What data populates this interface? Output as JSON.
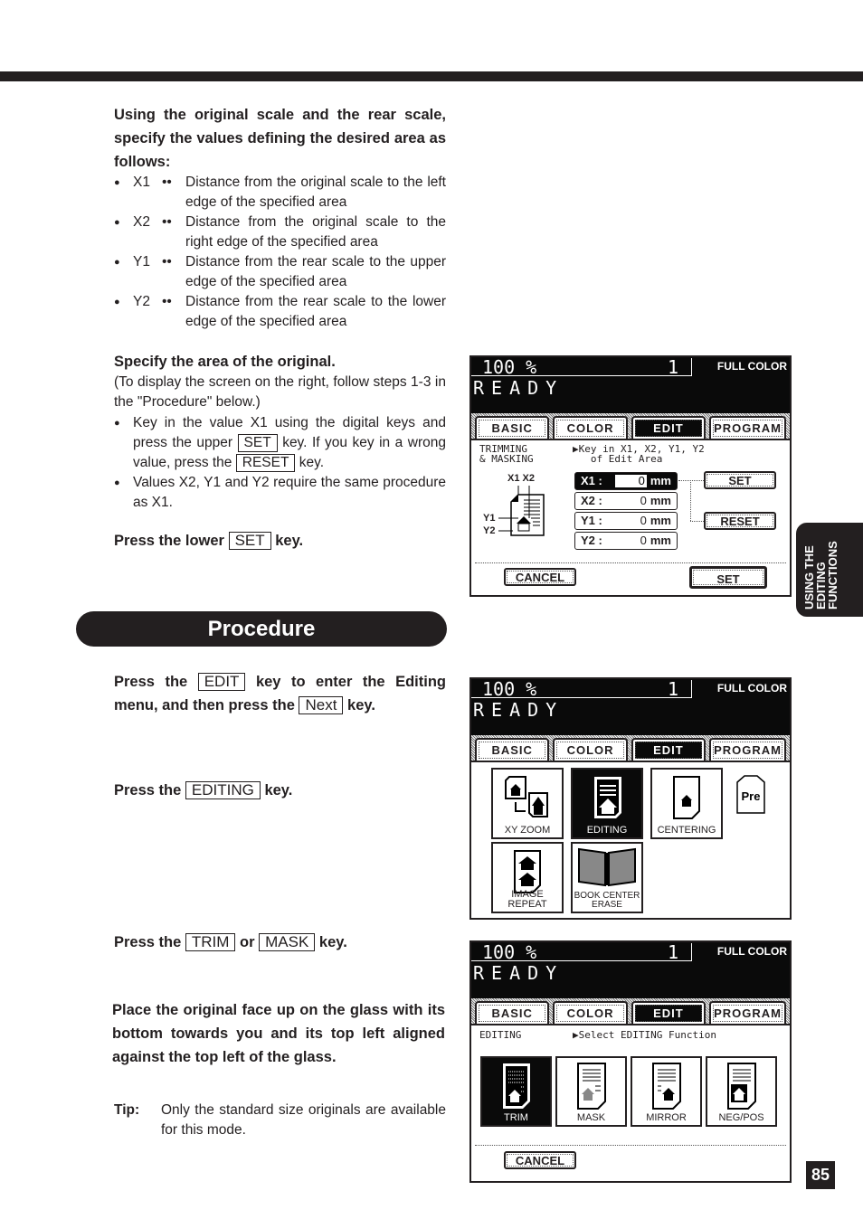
{
  "section1": {
    "heading": "Using the original scale and the rear scale, specify the values defining the desired area as follows:",
    "definitions": [
      {
        "term": "X1",
        "sep": "••",
        "desc": "Distance from the original scale to the left edge of the specified area"
      },
      {
        "term": "X2",
        "sep": "••",
        "desc": "Distance from the original scale to the right edge of the specified area"
      },
      {
        "term": "Y1",
        "sep": "••",
        "desc": "Distance from the rear scale to the upper edge of the specified area"
      },
      {
        "term": "Y2",
        "sep": "••",
        "desc": "Distance from the rear scale to the lower edge of the specified area"
      }
    ]
  },
  "section2": {
    "heading": "Specify the area of the original.",
    "note": "(To display the screen on the right, follow steps 1-3 in the \"Procedure\" below.)",
    "bullet1_a": "Key in the value X1 using the digital keys and press the upper",
    "bullet1_key1": "SET",
    "bullet1_b": "key.  If you key in a wrong value, press the",
    "bullet1_key2": "RESET",
    "bullet1_c": "key.",
    "bullet2": "Values X2, Y1 and Y2 require the same procedure as X1.",
    "press_a": "Press the lower",
    "press_key": "SET",
    "press_b": "key."
  },
  "procedure": {
    "title": "Procedure",
    "step1_a": "Press the",
    "step1_key1": "EDIT",
    "step1_b": "key to enter the Editing menu, and then press the",
    "step1_key2": "Next",
    "step1_c": "key.",
    "step2_a": "Press the",
    "step2_key": "EDITING",
    "step2_b": "key.",
    "step3_a": "Press the",
    "step3_key1": "TRIM",
    "step3_or": "or",
    "step3_key2": "MASK",
    "step3_b": "key.",
    "step4": "Place the original face up on the glass with its bottom towards you and its top left aligned against the top left of the glass.",
    "tip_label": "Tip:",
    "tip_text": "Only the standard size originals are available for this mode."
  },
  "side_tab": {
    "line1": "USING THE",
    "line2": "EDITING",
    "line3": "FUNCTIONS"
  },
  "page_number": "85",
  "lcd_common": {
    "zoom": "100  %",
    "copies": "1",
    "mode": "FULL COLOR",
    "status": "READY",
    "tabs": [
      "BASIC",
      "COLOR",
      "EDIT",
      "PROGRAM"
    ],
    "active_tab": "EDIT"
  },
  "lcd1": {
    "function": "TRIMMING\n& MASKING",
    "prompt": "▶Key in X1, X2, Y1, Y2\n   of Edit Area",
    "diagram_labels": {
      "x": "X1 X2",
      "y1": "Y1",
      "y2": "Y2"
    },
    "fields": [
      {
        "label": "X1 :",
        "value": "0",
        "unit": "mm",
        "active": true
      },
      {
        "label": "X2 :",
        "value": "0",
        "unit": "mm"
      },
      {
        "label": "Y1 :",
        "value": "0",
        "unit": "mm"
      },
      {
        "label": "Y2 :",
        "value": "0",
        "unit": "mm"
      }
    ],
    "upper_set": "SET",
    "reset": "RESET",
    "cancel": "CANCEL",
    "lower_set": "SET"
  },
  "lcd2": {
    "buttons": [
      "XY ZOOM",
      "EDITING",
      "CENTERING",
      "IMAGE REPEAT",
      "BOOK CENTER\nERASE"
    ],
    "active": "EDITING",
    "pre_label": "Pre"
  },
  "lcd3": {
    "function": "EDITING",
    "prompt": "▶Select EDITING Function",
    "buttons": [
      "TRIM",
      "MASK",
      "MIRROR",
      "NEG/POS"
    ],
    "active": "TRIM",
    "cancel": "CANCEL"
  }
}
